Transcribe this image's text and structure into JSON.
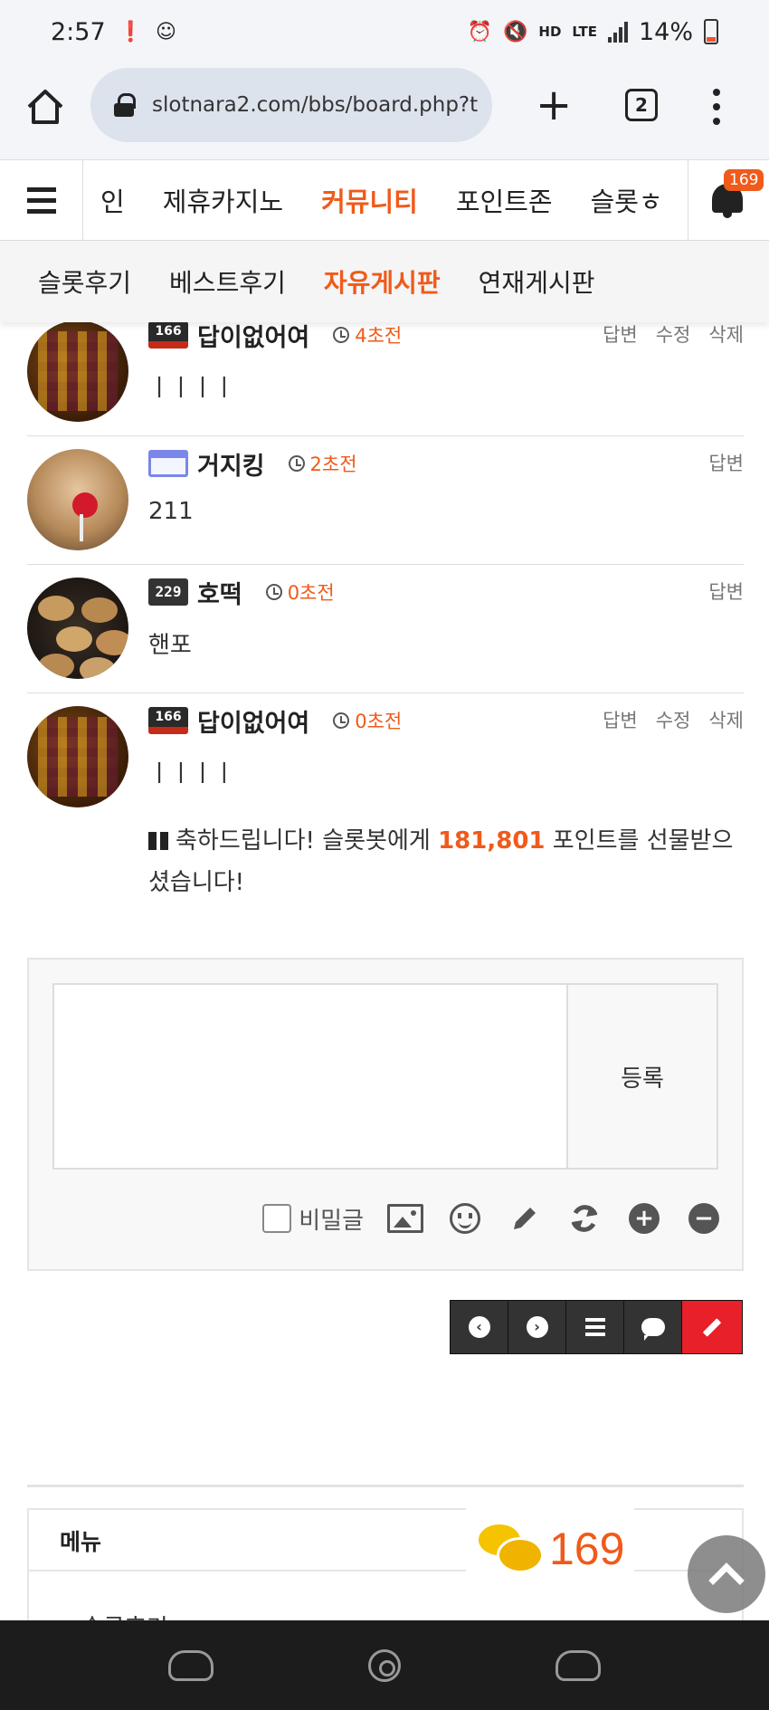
{
  "status": {
    "time": "2:57",
    "net_hd": "HD",
    "net_lte": "LTE",
    "battery": "14%"
  },
  "browser": {
    "url": "slotnara2.com/bbs/board.php?t",
    "tab_count": "2"
  },
  "nav": {
    "items": [
      "인",
      "제휴카지노",
      "커뮤니티",
      "포인트존",
      "슬롯ㅎ"
    ],
    "active_index": 2,
    "notification_count": "169"
  },
  "subnav": {
    "items": [
      "슬롯후기",
      "베스트후기",
      "자유게시판",
      "연재게시판"
    ],
    "active_index": 2
  },
  "comments": [
    {
      "level": "166",
      "level_style": "red",
      "nick": "답이없어여",
      "ago": "4초전",
      "text": "ㅣㅣㅣㅣ",
      "actions": [
        "답변",
        "수정",
        "삭제"
      ],
      "avatar": "slot"
    },
    {
      "level": "",
      "level_style": "blue",
      "nick": "거지킹",
      "ago": "2초전",
      "text": "211",
      "actions": [
        "답변"
      ],
      "avatar": "cat"
    },
    {
      "level": "229",
      "level_style": "dark",
      "nick": "호떡",
      "ago": "0초전",
      "text": "핸포",
      "actions": [
        "답변"
      ],
      "avatar": "food"
    },
    {
      "level": "166",
      "level_style": "red",
      "nick": "답이없어여",
      "ago": "0초전",
      "text": "ㅣㅣㅣㅣ",
      "actions": [
        "답변",
        "수정",
        "삭제"
      ],
      "avatar": "slot"
    }
  ],
  "gift": {
    "before": "축하드립니다! 슬롯봇에게 ",
    "points": "181,801",
    "after": " 포인트를 선물받으셨습니다!"
  },
  "form": {
    "submit_label": "등록",
    "secret_label": "비밀글"
  },
  "menu": {
    "title": "메뉴",
    "first_item": "슬롯후기"
  },
  "floating": {
    "comment_count": "169"
  },
  "colors": {
    "accent": "#f05a1a",
    "write_button": "#e8202a"
  }
}
